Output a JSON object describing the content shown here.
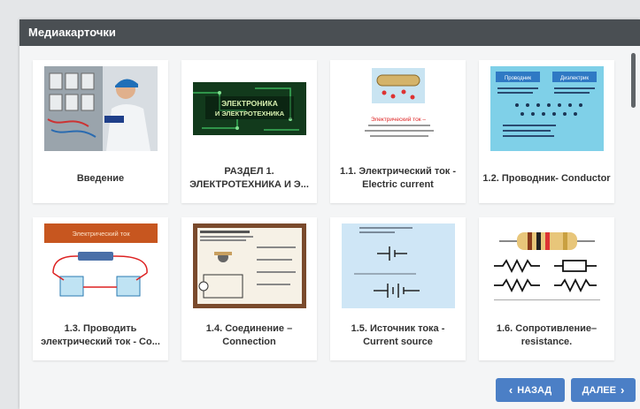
{
  "window": {
    "title": "Медиакарточки"
  },
  "cards": [
    {
      "title": "Введение",
      "thumbnail": "electrician-at-panel"
    },
    {
      "title": "РАЗДЕЛ 1. ЭЛЕКТРОТЕХНИКА И Э...",
      "thumbnail": "circuit-board-slide",
      "thumbnail_text": "ЭЛЕКТРОНИКА И ЭЛЕКТРОТЕХНИКА"
    },
    {
      "title": "1.1. Электрический ток - Electric current",
      "thumbnail": "electric-current-slide",
      "thumbnail_text": "Электрический ток –"
    },
    {
      "title": "1.2. Проводник- Conductor",
      "thumbnail": "conductor-slide",
      "thumbnail_text": [
        "Проводник",
        "Диэлектрик"
      ]
    },
    {
      "title": "1.3. Проводить электрический ток - Co...",
      "thumbnail": "conduction-slide",
      "thumbnail_text": "Электрический ток"
    },
    {
      "title": "1.4. Соединение – Connection",
      "thumbnail": "connection-slide"
    },
    {
      "title": "1.5. Источник тока - Current source",
      "thumbnail": "current-source-slide"
    },
    {
      "title": "1.6. Сопротивление– resistance.",
      "thumbnail": "resistor-slide"
    }
  ],
  "navigation": {
    "back_label": "НАЗАД",
    "next_label": "ДАЛЕЕ"
  },
  "colors": {
    "header": "#4a4f53",
    "button": "#4b7fc6",
    "panel": "#f4f5f6"
  }
}
